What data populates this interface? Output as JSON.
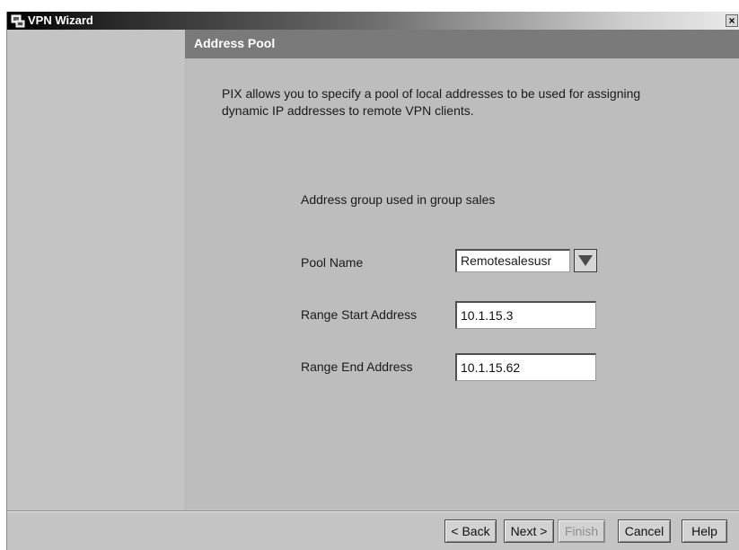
{
  "window": {
    "title": "VPN Wizard",
    "close_glyph": "×"
  },
  "step": {
    "title": "Address Pool"
  },
  "main": {
    "intro": "PIX allows you to specify a pool of local addresses to be used for assigning dynamic IP addresses to remote VPN clients.",
    "group_label": "Address group used in group sales",
    "pool_name": {
      "label": "Pool Name",
      "value": "Remotesalesusr"
    },
    "range_start": {
      "label": "Range Start Address",
      "value": "10.1.15.3"
    },
    "range_end": {
      "label": "Range End Address",
      "value": "10.1.15.62"
    }
  },
  "buttons": {
    "back": "< Back",
    "next": "Next >",
    "finish": "Finish",
    "cancel": "Cancel",
    "help": "Help"
  },
  "icons": {
    "app": "vpn-wizard-app-icon",
    "close": "close-icon",
    "dropdown": "triangle-down-icon"
  },
  "colors": {
    "step_header_bg": "#7a7a7a",
    "content_bg": "#bdbdbd",
    "window_bg": "#c4c4c4"
  }
}
